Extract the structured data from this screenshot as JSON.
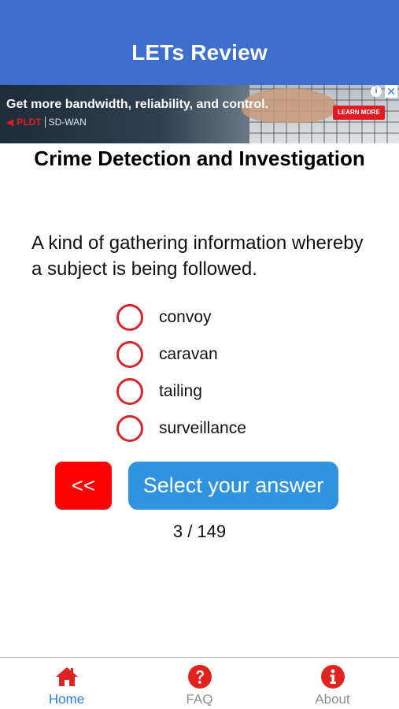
{
  "header": {
    "title": "LETs Review"
  },
  "ad": {
    "headline": "Get more bandwidth, reliability, and control.",
    "brand": "PLDT",
    "product": "SD-WAN",
    "cta": "LEARN MORE",
    "info_glyph": "i",
    "close_glyph": "✕"
  },
  "quiz": {
    "subject": "Crime Detection and Investigation",
    "question": "A kind of gathering information whereby a subject is being followed.",
    "options": [
      {
        "label": "convoy"
      },
      {
        "label": "caravan"
      },
      {
        "label": "tailing"
      },
      {
        "label": "surveillance"
      }
    ],
    "back_label": "<<",
    "submit_label": "Select your answer",
    "progress": "3 / 149"
  },
  "tabs": [
    {
      "label": "Home",
      "icon": "home-icon",
      "active": true
    },
    {
      "label": "FAQ",
      "icon": "question-circle-icon",
      "active": false
    },
    {
      "label": "About",
      "icon": "info-circle-icon",
      "active": false
    }
  ],
  "colors": {
    "header_bg": "#3f6fcc",
    "accent_red": "#ff0000",
    "radio_red": "#d6262d",
    "submit_blue": "#2f93df",
    "tab_active": "#2f7ddf",
    "tab_inactive": "#8e8e8e",
    "tab_icon_red": "#e0231f"
  }
}
